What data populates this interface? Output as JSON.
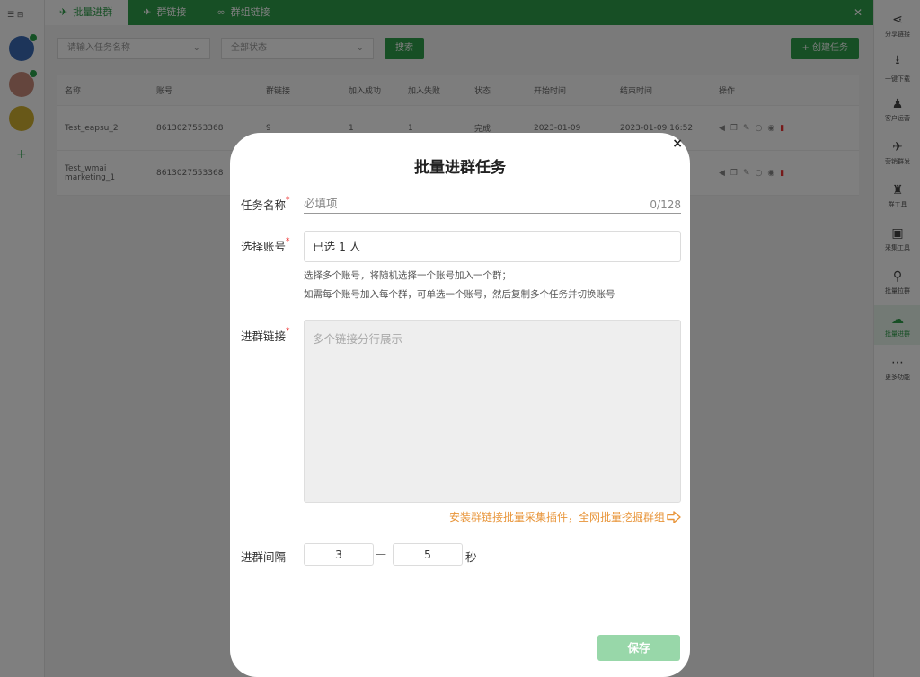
{
  "background": {
    "menu_icon": "list-icon",
    "tabs": [
      {
        "label": "批量进群",
        "icon": "megaphone-icon"
      },
      {
        "label": "群链接",
        "icon": "megaphone-icon"
      },
      {
        "label": "群组链接",
        "icon": "chain-icon"
      }
    ],
    "close_label": "✕",
    "filter_account": "请输入任务名称",
    "filter_status": "全部状态",
    "search_label": "搜索",
    "create_label": "+ 创建任务",
    "table_headers": [
      "名称",
      "账号",
      "群链接",
      "加入成功",
      "加入失败",
      "状态",
      "开始时间",
      "结束时间",
      "操作"
    ],
    "rows": [
      [
        "Test_eapsu_2",
        "8613027553368",
        "9",
        "1",
        "1",
        "完成",
        "2023-01-09",
        "2023-01-09 16:52",
        ""
      ],
      [
        "Test_wmai marketing_1",
        "8613027553368",
        "",
        "",
        "",
        "",
        "",
        "2023-01-09",
        ""
      ]
    ],
    "right_items": [
      {
        "label": "分享链接",
        "icon": "share-icon"
      },
      {
        "label": "一键下载",
        "icon": "download-icon"
      },
      {
        "label": "客户运营",
        "icon": "users-icon"
      },
      {
        "label": "营销群发",
        "icon": "megaphone-icon"
      },
      {
        "label": "群工具",
        "icon": "group-icon"
      },
      {
        "label": "采集工具",
        "icon": "collect-icon"
      },
      {
        "label": "批量拉群",
        "icon": "pull-icon"
      },
      {
        "label": "批量进群",
        "icon": "join-icon"
      },
      {
        "label": "更多功能",
        "icon": "more-icon"
      }
    ]
  },
  "dialog": {
    "title": "批量进群任务",
    "close_label": "×",
    "required_mark": "*",
    "task_name_label": "任务名称",
    "task_name_placeholder": "必填项",
    "task_name_count": "0/128",
    "account_label": "选择账号",
    "account_value": "已选 1 人",
    "account_hint_1": "选择多个账号，将随机选择一个账号加入一个群；",
    "account_hint_2": "如需每个账号加入每个群，可单选一个账号，然后复制多个任务并切换账号",
    "links_label": "进群链接",
    "links_placeholder": "多个链接分行展示",
    "plugin_link_text": "安装群链接批量采集插件，全网批量挖掘群组",
    "plugin_link_icon": "arrow-right-icon",
    "interval_label": "进群间隔",
    "interval_min": "3",
    "interval_dash": "—",
    "interval_max": "5",
    "interval_unit": "秒",
    "save_label": "保存"
  },
  "colors": {
    "brand_green": "#2e9e4a",
    "save_disabled": "#98d7a9",
    "link_orange": "#e8953a",
    "required_red": "#e33333"
  }
}
